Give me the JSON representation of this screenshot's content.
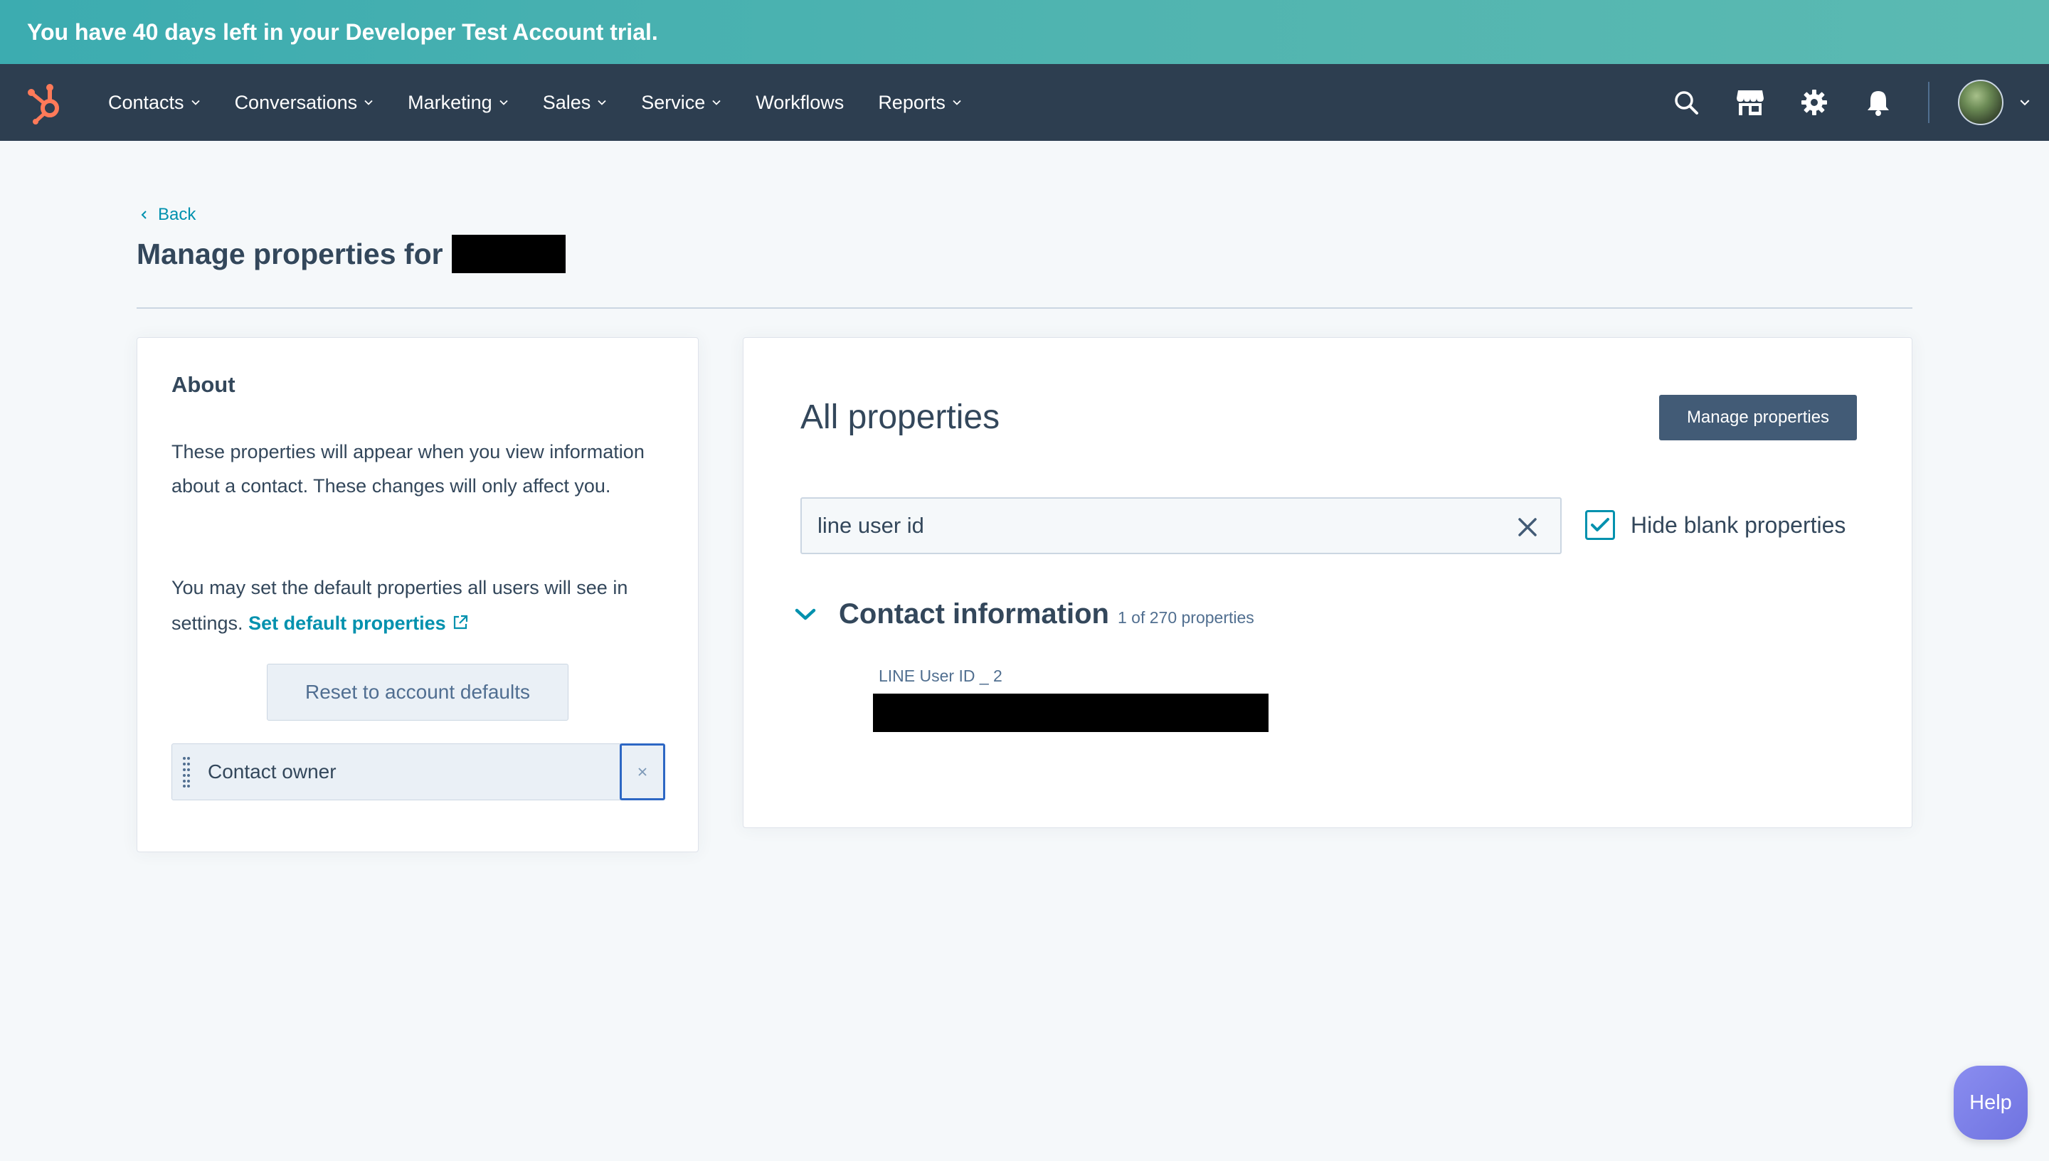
{
  "banner": {
    "text": "You have 40 days left in your Developer Test Account trial."
  },
  "nav": {
    "items": [
      {
        "label": "Contacts",
        "has_dropdown": true
      },
      {
        "label": "Conversations",
        "has_dropdown": true
      },
      {
        "label": "Marketing",
        "has_dropdown": true
      },
      {
        "label": "Sales",
        "has_dropdown": true
      },
      {
        "label": "Service",
        "has_dropdown": true
      },
      {
        "label": "Workflows",
        "has_dropdown": false
      },
      {
        "label": "Reports",
        "has_dropdown": true
      }
    ],
    "icons": [
      "search-icon",
      "marketplace-icon",
      "gear-icon",
      "bell-icon"
    ],
    "colors": {
      "bar": "#2d3e50",
      "logo": "#ff7a59"
    }
  },
  "page": {
    "back_label": "Back",
    "title": "Manage properties for"
  },
  "about": {
    "title": "About",
    "text1": "These properties will appear when you view information about a contact. These changes will only affect you.",
    "text2": "You may set the default properties all users will see in settings.",
    "default_link": "Set default properties",
    "reset_label": "Reset to account defaults",
    "selected_property": "Contact owner"
  },
  "properties": {
    "title": "All properties",
    "manage_label": "Manage properties",
    "search_value": "line user id",
    "hide_blank_label": "Hide blank properties",
    "hide_blank_checked": true,
    "section": {
      "title": "Contact information",
      "count": "1 of 270 properties",
      "items": [
        {
          "label": "LINE User ID _ 2"
        }
      ]
    }
  },
  "help_label": "Help"
}
